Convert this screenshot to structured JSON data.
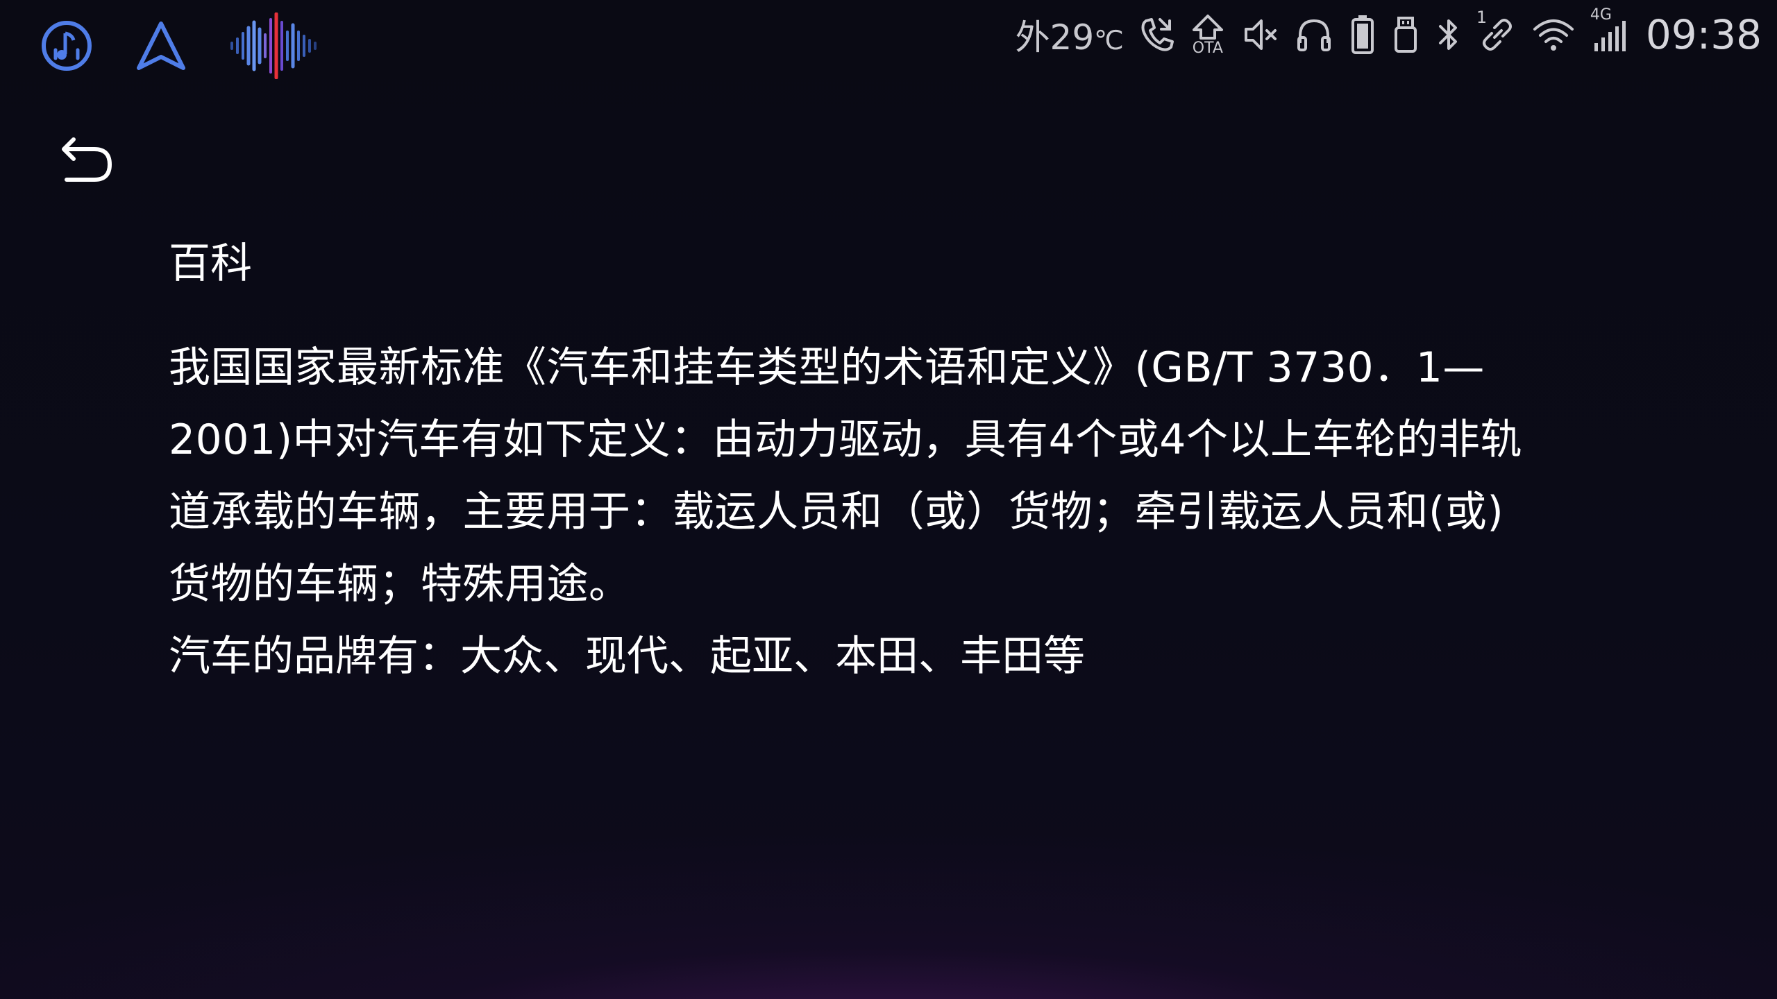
{
  "apps": [
    {
      "name": "music-app-icon"
    },
    {
      "name": "navigation-app-icon"
    },
    {
      "name": "voice-assistant-icon"
    }
  ],
  "status": {
    "temperature_prefix": "外",
    "temperature_value": "29",
    "temperature_unit": "℃",
    "ota_label": "OTA",
    "link_count": "1",
    "network_type": "4G",
    "time": "09:38",
    "colors": {
      "icon": "#c9c9cf",
      "clock": "#d6d6dc"
    }
  },
  "page": {
    "title": "百科",
    "definition_line_1": "我国国家最新标准《汽车和挂车类型的术语和定义》(GB/T 3730．1—",
    "definition_line_2": "2001)中对汽车有如下定义：由动力驱动，具有4个或4个以上车轮的非轨",
    "definition_line_3": "道承载的车辆，主要用于：载运人员和（或）货物；牵引载运人员和(或)",
    "definition_line_4": "货物的车辆；特殊用途。",
    "brands": "汽车的品牌有：大众、现代、起亚、本田、丰田等"
  },
  "theme": {
    "background": "#0b0b16",
    "accent_blue": "#4f7de8",
    "glow_purple": "#561a6e",
    "text": "#ffffff"
  }
}
